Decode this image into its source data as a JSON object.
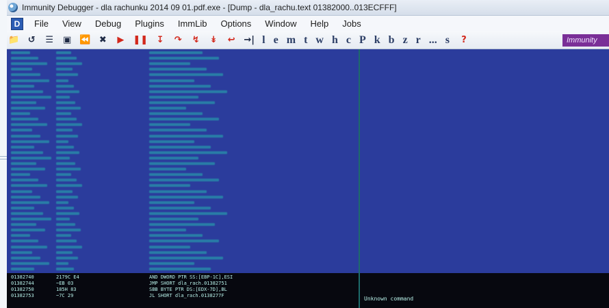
{
  "window": {
    "title": "Immunity Debugger - dla rachunku 2014 09 01.pdf.exe - [Dump - dla_rachu.text 01382000..013ECFFF]"
  },
  "menu": {
    "items": [
      "File",
      "View",
      "Debug",
      "Plugins",
      "ImmLib",
      "Options",
      "Window",
      "Help",
      "Jobs"
    ]
  },
  "toolbar": {
    "letters": [
      "l",
      "e",
      "m",
      "t",
      "w",
      "h",
      "c",
      "P",
      "k",
      "b",
      "z",
      "r",
      "...",
      "s"
    ],
    "help": "?",
    "brand": "Immunity"
  },
  "dump": {
    "rows": [
      {
        "addr": "01382740",
        "hex": "2179C E4",
        "dis": "AND DWORD PTR SS:[EBP-1C],ESI"
      },
      {
        "addr": "01382744",
        "hex": "~EB 03",
        "dis": "JMP SHORT dla_rach.01382751"
      },
      {
        "addr": "01382750",
        "hex": "185H 83",
        "dis": "SBB BYTE PTR DS:[EDX-7D],BL"
      },
      {
        "addr": "01382753",
        "hex": "~7C 29",
        "dis": "JL SHORT dla_rach.0138277F"
      }
    ],
    "status": "Unknown command"
  },
  "colors": {
    "pane_bg": "#2b3c9c",
    "text": "#27c6b8",
    "lower_bg": "#07080f",
    "brand_bg": "#7a2f97"
  }
}
